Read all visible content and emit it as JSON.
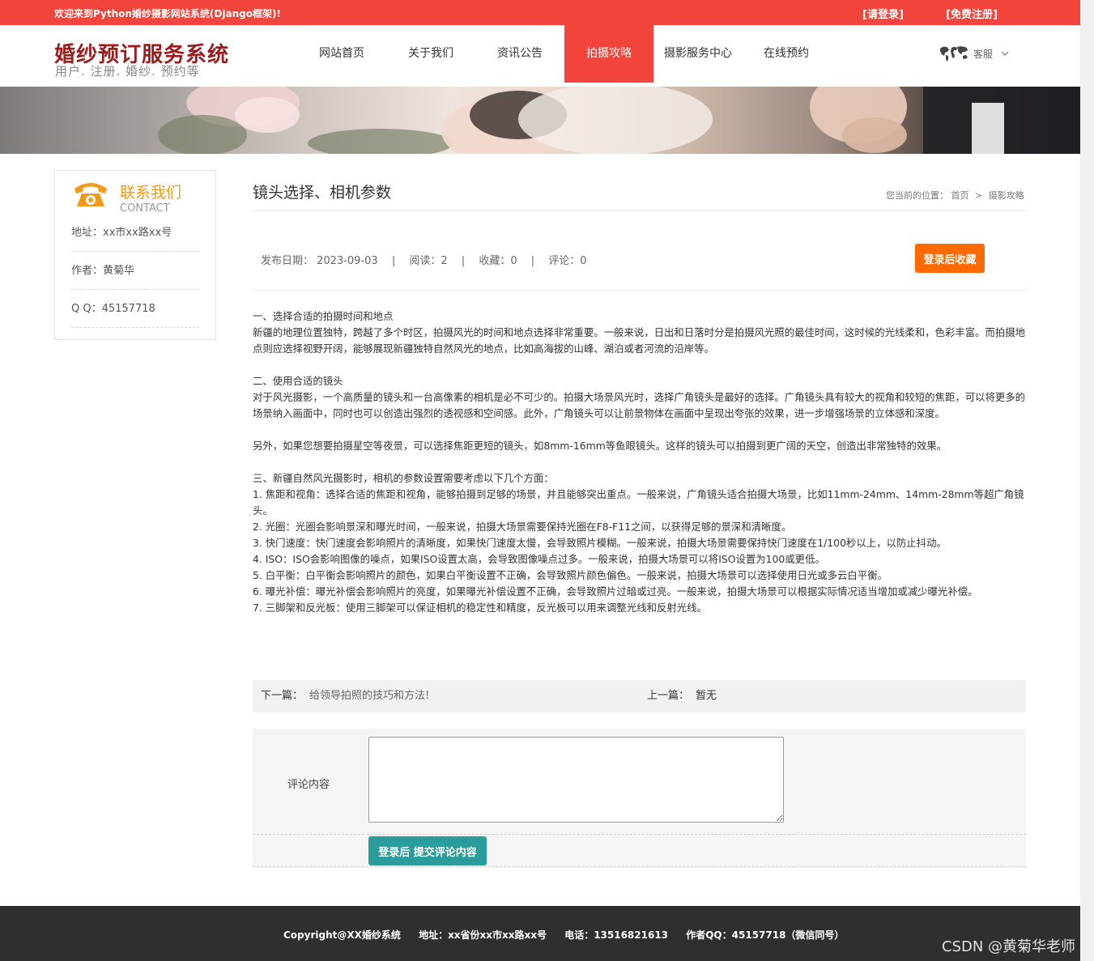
{
  "topbar": {
    "welcome": "欢迎来到Python婚纱摄影网站系统(Django框架)!",
    "login": "[请登录]",
    "register": "[免费注册]"
  },
  "header": {
    "logo_title": "婚纱预订服务系统",
    "logo_sub": "用户. 注册. 婚纱. 预约等",
    "nav": [
      "网站首页",
      "关于我们",
      "资讯公告",
      "拍摄攻略",
      "摄影服务中心",
      "在线预约"
    ],
    "active_nav": "拍摄攻略",
    "service": "客服"
  },
  "sidebar": {
    "title": "联系我们",
    "title_en": "CONTACT",
    "address": "地址：xx市xx路xx号",
    "author": "作者：黄菊华",
    "qq": "Q Q：45157718"
  },
  "article": {
    "title": "镜头选择、相机参数",
    "breadcrumb_prefix": "您当前的位置：",
    "breadcrumb_home": "首页",
    "breadcrumb_sep": ">",
    "breadcrumb_current": "摄影攻略",
    "meta": {
      "date": "发布日期： 2023-09-03",
      "reads": "阅读：2",
      "favorites": "收藏：0",
      "comments": "评论：0",
      "sep": "|"
    },
    "favorite_button": "登录后收藏",
    "paragraphs": [
      "一、选择合适的拍摄时间和地点",
      "新疆的地理位置独特，跨越了多个时区，拍摄风光的时间和地点选择非常重要。一般来说，日出和日落时分是拍摄风光照的最佳时间，这时候的光线柔和，色彩丰富。而拍摄地点则应选择视野开阔，能够展现新疆独特自然风光的地点，比如高海拔的山峰、湖泊或者河流的沿岸等。",
      "",
      "二、使用合适的镜头",
      "对于风光摄影，一个高质量的镜头和一台高像素的相机是必不可少的。拍摄大场景风光时，选择广角镜头是最好的选择。广角镜头具有较大的视角和较短的焦距，可以将更多的场景纳入画面中，同时也可以创造出强烈的透视感和空间感。此外，广角镜头可以让前景物体在画面中呈现出夸张的效果，进一步增强场景的立体感和深度。",
      "",
      "另外，如果您想要拍摄星空等夜景，可以选择焦距更短的镜头，如8mm-16mm等鱼眼镜头。这样的镜头可以拍摄到更广阔的天空，创造出非常独特的效果。",
      "",
      "三、新疆自然风光摄影时，相机的参数设置需要考虑以下几个方面：",
      "1. 焦距和视角：选择合适的焦距和视角，能够拍摄到足够的场景，并且能够突出重点。一般来说，广角镜头适合拍摄大场景，比如11mm-24mm、14mm-28mm等超广角镜头。",
      "2. 光圈：光圈会影响景深和曝光时间，一般来说，拍摄大场景需要保持光圈在F8-F11之间，以获得足够的景深和清晰度。",
      "3. 快门速度：快门速度会影响照片的清晰度，如果快门速度太慢，会导致照片模糊。一般来说，拍摄大场景需要保持快门速度在1/100秒以上，以防止抖动。",
      "4. ISO：ISO会影响图像的噪点，如果ISO设置太高，会导致图像噪点过多。一般来说，拍摄大场景可以将ISO设置为100或更低。",
      "5. 白平衡：白平衡会影响照片的颜色，如果白平衡设置不正确，会导致照片颜色偏色。一般来说，拍摄大场景可以选择使用日光或多云白平衡。",
      "6. 曝光补偿：曝光补偿会影响照片的亮度，如果曝光补偿设置不正确，会导致照片过暗或过亮。一般来说，拍摄大场景可以根据实际情况适当增加或减少曝光补偿。",
      "7. 三脚架和反光板：使用三脚架可以保证相机的稳定性和精度，反光板可以用来调整光线和反射光线。"
    ],
    "next_label": "下一篇：",
    "next_title": "给领导拍照的技巧和方法!",
    "prev_label": "上一篇：",
    "prev_title": "暂无"
  },
  "comment": {
    "label": "评论内容",
    "value": "",
    "submit": "登录后 提交评论内容"
  },
  "footer": {
    "copyright": "Copyright@XX婚纱系统",
    "address": "地址：xx省份xx市xx路xx号",
    "phone": "电话：13516821613",
    "qq": "作者QQ：45157718（微信同号）",
    "watermark": "CSDN @黄菊华老师"
  },
  "colors": {
    "brand_red": "#f2443a",
    "logo_red": "#9b1c1c",
    "orange_button": "#ff6a00",
    "teal_button": "#2a9d9a",
    "contact_orange": "#f29b1b",
    "footer_bg": "#2f2f2f"
  },
  "icons": {
    "contact": "telephone-icon",
    "service": "world-map-icon",
    "dropdown": "chevron-down-icon"
  }
}
